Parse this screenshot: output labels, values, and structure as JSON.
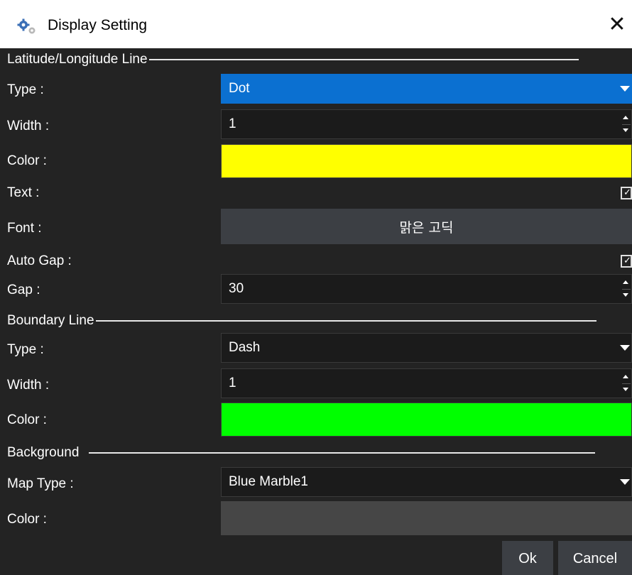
{
  "window": {
    "title": "Display Setting",
    "close_glyph": "✕",
    "icon": "gears-icon"
  },
  "latlon": {
    "heading": "Latitude/Longitude Line",
    "type_label": "Type :",
    "type_value": "Dot",
    "width_label": "Width :",
    "width_value": "1",
    "color_label": "Color :",
    "color_value": "#ffff00",
    "text_label": "Text :",
    "text_checked": true,
    "font_label": "Font :",
    "font_value": "맑은 고딕",
    "autogap_label": "Auto Gap :",
    "autogap_checked": true,
    "gap_label": "Gap :",
    "gap_value": "30"
  },
  "boundary": {
    "heading": "Boundary Line",
    "type_label": "Type :",
    "type_value": "Dash",
    "width_label": "Width :",
    "width_value": "1",
    "color_label": "Color :",
    "color_value": "#00ff00"
  },
  "background": {
    "heading": "Background",
    "maptype_label": "Map Type :",
    "maptype_value": "Blue Marble1",
    "color_label": "Color :",
    "color_value": "#464646"
  },
  "buttons": {
    "ok": "Ok",
    "cancel": "Cancel"
  },
  "colors": {
    "accent": "#0b70d1",
    "window_bg": "#232323"
  }
}
